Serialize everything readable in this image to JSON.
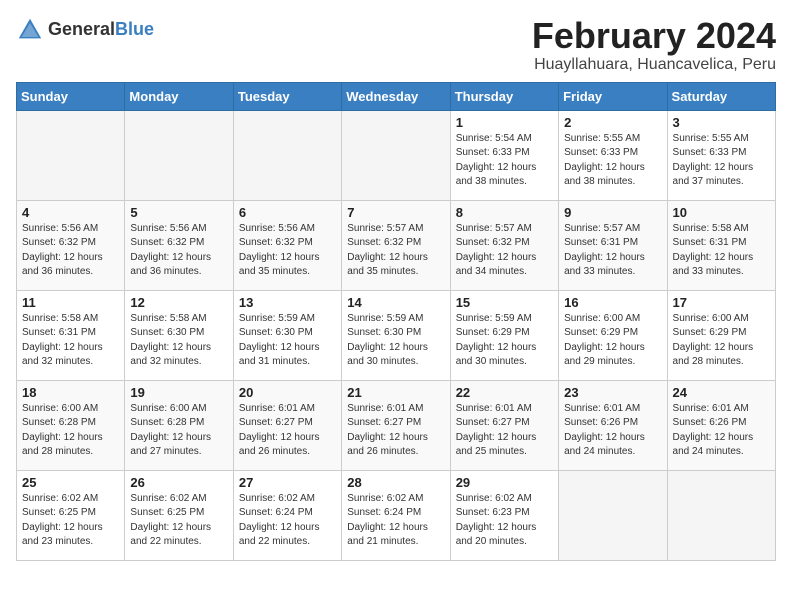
{
  "logo": {
    "general": "General",
    "blue": "Blue"
  },
  "header": {
    "month": "February 2024",
    "location": "Huayllahuara, Huancavelica, Peru"
  },
  "weekdays": [
    "Sunday",
    "Monday",
    "Tuesday",
    "Wednesday",
    "Thursday",
    "Friday",
    "Saturday"
  ],
  "weeks": [
    [
      {
        "day": "",
        "info": ""
      },
      {
        "day": "",
        "info": ""
      },
      {
        "day": "",
        "info": ""
      },
      {
        "day": "",
        "info": ""
      },
      {
        "day": "1",
        "info": "Sunrise: 5:54 AM\nSunset: 6:33 PM\nDaylight: 12 hours\nand 38 minutes."
      },
      {
        "day": "2",
        "info": "Sunrise: 5:55 AM\nSunset: 6:33 PM\nDaylight: 12 hours\nand 38 minutes."
      },
      {
        "day": "3",
        "info": "Sunrise: 5:55 AM\nSunset: 6:33 PM\nDaylight: 12 hours\nand 37 minutes."
      }
    ],
    [
      {
        "day": "4",
        "info": "Sunrise: 5:56 AM\nSunset: 6:32 PM\nDaylight: 12 hours\nand 36 minutes."
      },
      {
        "day": "5",
        "info": "Sunrise: 5:56 AM\nSunset: 6:32 PM\nDaylight: 12 hours\nand 36 minutes."
      },
      {
        "day": "6",
        "info": "Sunrise: 5:56 AM\nSunset: 6:32 PM\nDaylight: 12 hours\nand 35 minutes."
      },
      {
        "day": "7",
        "info": "Sunrise: 5:57 AM\nSunset: 6:32 PM\nDaylight: 12 hours\nand 35 minutes."
      },
      {
        "day": "8",
        "info": "Sunrise: 5:57 AM\nSunset: 6:32 PM\nDaylight: 12 hours\nand 34 minutes."
      },
      {
        "day": "9",
        "info": "Sunrise: 5:57 AM\nSunset: 6:31 PM\nDaylight: 12 hours\nand 33 minutes."
      },
      {
        "day": "10",
        "info": "Sunrise: 5:58 AM\nSunset: 6:31 PM\nDaylight: 12 hours\nand 33 minutes."
      }
    ],
    [
      {
        "day": "11",
        "info": "Sunrise: 5:58 AM\nSunset: 6:31 PM\nDaylight: 12 hours\nand 32 minutes."
      },
      {
        "day": "12",
        "info": "Sunrise: 5:58 AM\nSunset: 6:30 PM\nDaylight: 12 hours\nand 32 minutes."
      },
      {
        "day": "13",
        "info": "Sunrise: 5:59 AM\nSunset: 6:30 PM\nDaylight: 12 hours\nand 31 minutes."
      },
      {
        "day": "14",
        "info": "Sunrise: 5:59 AM\nSunset: 6:30 PM\nDaylight: 12 hours\nand 30 minutes."
      },
      {
        "day": "15",
        "info": "Sunrise: 5:59 AM\nSunset: 6:29 PM\nDaylight: 12 hours\nand 30 minutes."
      },
      {
        "day": "16",
        "info": "Sunrise: 6:00 AM\nSunset: 6:29 PM\nDaylight: 12 hours\nand 29 minutes."
      },
      {
        "day": "17",
        "info": "Sunrise: 6:00 AM\nSunset: 6:29 PM\nDaylight: 12 hours\nand 28 minutes."
      }
    ],
    [
      {
        "day": "18",
        "info": "Sunrise: 6:00 AM\nSunset: 6:28 PM\nDaylight: 12 hours\nand 28 minutes."
      },
      {
        "day": "19",
        "info": "Sunrise: 6:00 AM\nSunset: 6:28 PM\nDaylight: 12 hours\nand 27 minutes."
      },
      {
        "day": "20",
        "info": "Sunrise: 6:01 AM\nSunset: 6:27 PM\nDaylight: 12 hours\nand 26 minutes."
      },
      {
        "day": "21",
        "info": "Sunrise: 6:01 AM\nSunset: 6:27 PM\nDaylight: 12 hours\nand 26 minutes."
      },
      {
        "day": "22",
        "info": "Sunrise: 6:01 AM\nSunset: 6:27 PM\nDaylight: 12 hours\nand 25 minutes."
      },
      {
        "day": "23",
        "info": "Sunrise: 6:01 AM\nSunset: 6:26 PM\nDaylight: 12 hours\nand 24 minutes."
      },
      {
        "day": "24",
        "info": "Sunrise: 6:01 AM\nSunset: 6:26 PM\nDaylight: 12 hours\nand 24 minutes."
      }
    ],
    [
      {
        "day": "25",
        "info": "Sunrise: 6:02 AM\nSunset: 6:25 PM\nDaylight: 12 hours\nand 23 minutes."
      },
      {
        "day": "26",
        "info": "Sunrise: 6:02 AM\nSunset: 6:25 PM\nDaylight: 12 hours\nand 22 minutes."
      },
      {
        "day": "27",
        "info": "Sunrise: 6:02 AM\nSunset: 6:24 PM\nDaylight: 12 hours\nand 22 minutes."
      },
      {
        "day": "28",
        "info": "Sunrise: 6:02 AM\nSunset: 6:24 PM\nDaylight: 12 hours\nand 21 minutes."
      },
      {
        "day": "29",
        "info": "Sunrise: 6:02 AM\nSunset: 6:23 PM\nDaylight: 12 hours\nand 20 minutes."
      },
      {
        "day": "",
        "info": ""
      },
      {
        "day": "",
        "info": ""
      }
    ]
  ]
}
